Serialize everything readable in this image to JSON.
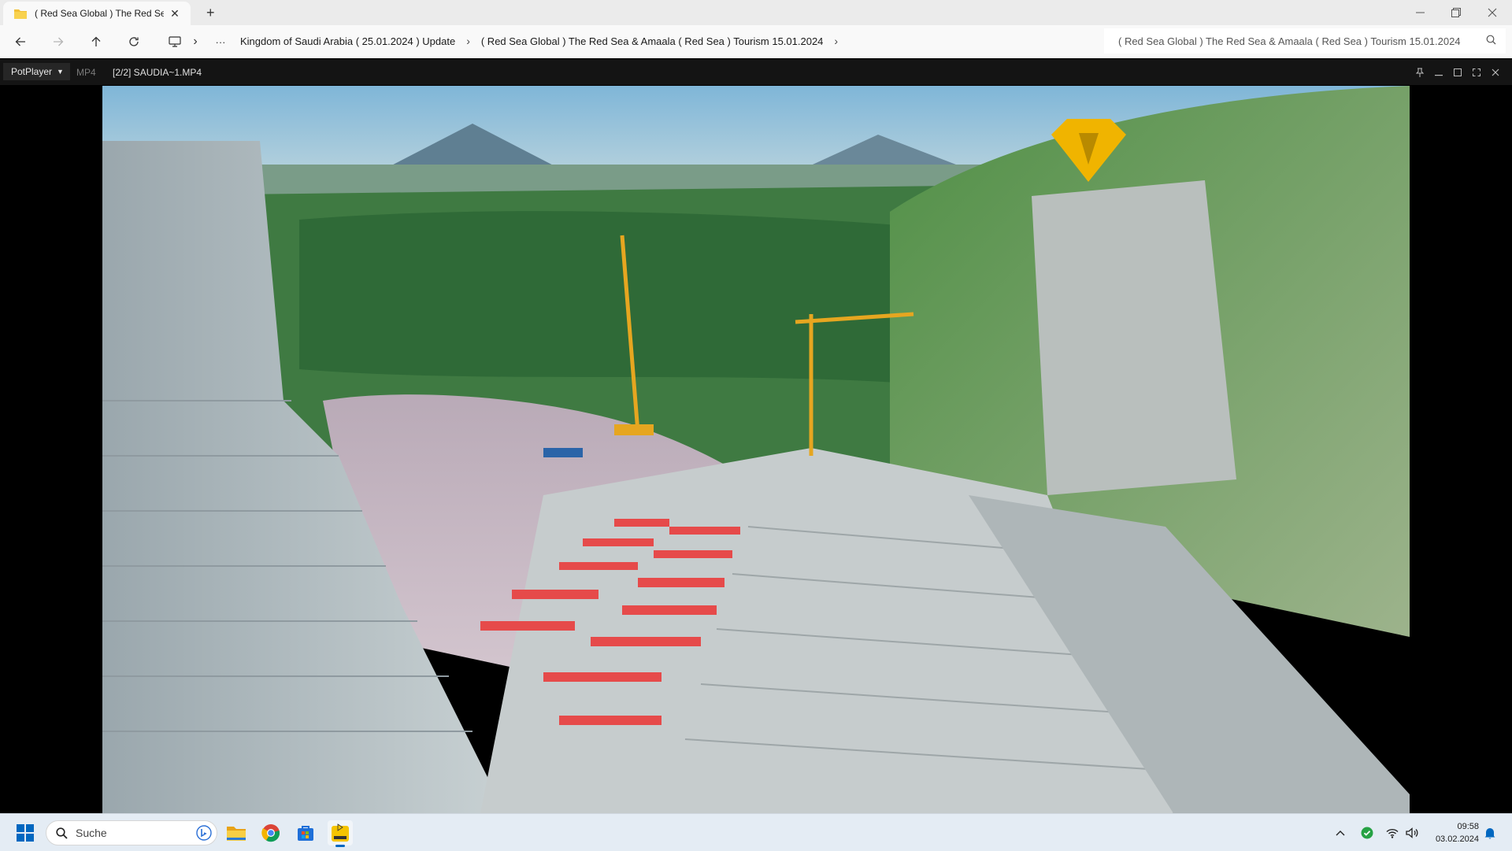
{
  "explorer": {
    "tab_title": "( Red Sea Global ) The Red Sea & Amaala ( Red Sea ) Tourism 15.01.2024",
    "breadcrumbs": [
      "Kingdom of Saudi Arabia ( 25.01.2024 ) Update",
      "( Red Sea Global ) The Red Sea & Amaala ( Red Sea ) Tourism 15.01.2024"
    ],
    "search_text": "( Red Sea Global ) The Red Sea & Amaala ( Red Sea ) Tourism 15.01.2024",
    "more_label": "···"
  },
  "player": {
    "menu_label": "PotPlayer",
    "format": "MP4",
    "file": "[2/2] SAUDIA~1.MP4"
  },
  "taskbar": {
    "search_placeholder": "Suche",
    "time": "09:58",
    "date": "03.02.2024",
    "pinned": [
      "file-explorer",
      "chrome",
      "microsoft-store",
      "potplayer"
    ]
  },
  "colors": {
    "accent_blue": "#0067c0",
    "player_bg": "#000000",
    "logo_gold": "#f0b400"
  }
}
